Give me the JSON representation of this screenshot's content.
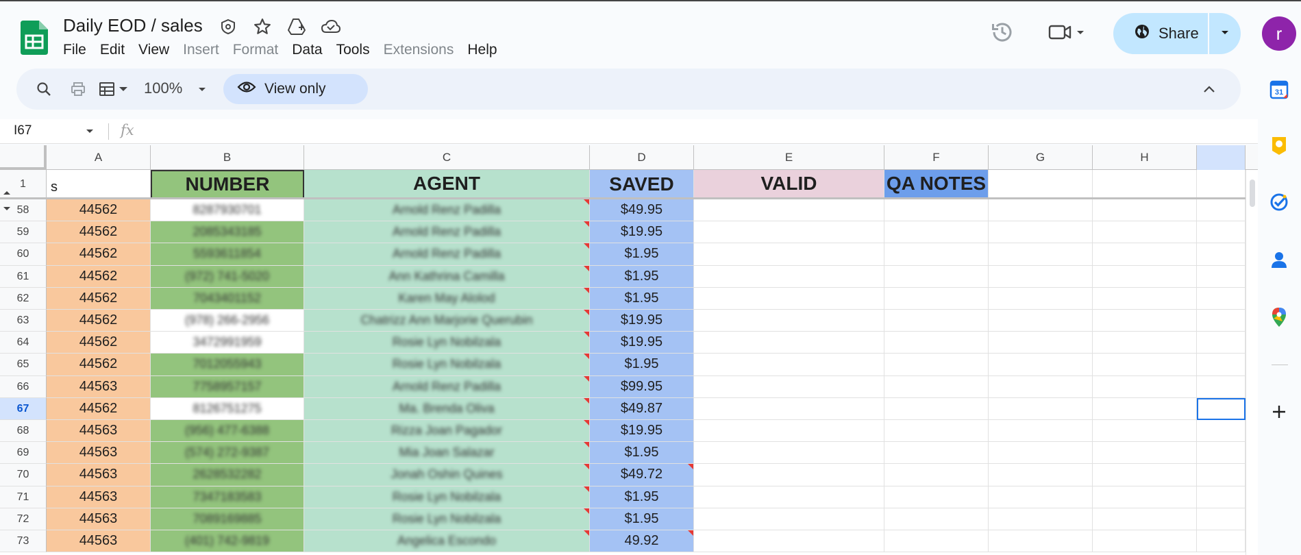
{
  "doc": {
    "title": "Daily EOD / sales"
  },
  "menu": [
    {
      "label": "File",
      "disabled": false
    },
    {
      "label": "Edit",
      "disabled": false
    },
    {
      "label": "View",
      "disabled": false
    },
    {
      "label": "Insert",
      "disabled": true
    },
    {
      "label": "Format",
      "disabled": true
    },
    {
      "label": "Data",
      "disabled": false
    },
    {
      "label": "Tools",
      "disabled": false
    },
    {
      "label": "Extensions",
      "disabled": true
    },
    {
      "label": "Help",
      "disabled": false
    }
  ],
  "header": {
    "share_label": "Share",
    "avatar_letter": "r"
  },
  "toolbar": {
    "zoom": "100%",
    "view_only_label": "View only"
  },
  "formula_bar": {
    "name_box": "I67",
    "fx_label": "fx",
    "content": ""
  },
  "colors": {
    "brand_green": "#0f9d58",
    "col_a": "#f9c89d",
    "col_b_green": "#93c47d",
    "col_c": "#b7e1cd",
    "col_d": "#a4c2f4",
    "valid_header": "#ead1dc",
    "qa_header": "#6d9eeb",
    "share_bg": "#c2e7ff"
  },
  "grid": {
    "columns": [
      "A",
      "B",
      "C",
      "D",
      "E",
      "F",
      "G",
      "H"
    ],
    "header_row": {
      "row_number": "1",
      "a": "s",
      "b": "NUMBER",
      "c": "AGENT",
      "d": "SAVED",
      "e": "VALID",
      "f": "QA NOTES"
    },
    "rows": [
      {
        "n": "58",
        "a": "44562",
        "b": "8287930701",
        "b_white": true,
        "c": "Arnold Renz Padilla",
        "d": "$49.95"
      },
      {
        "n": "59",
        "a": "44562",
        "b": "2085343185",
        "b_white": false,
        "c": "Arnold Renz Padilla",
        "d": "$19.95"
      },
      {
        "n": "60",
        "a": "44562",
        "b": "5593611854",
        "b_white": false,
        "c": "Arnold Renz Padilla",
        "d": "$1.95"
      },
      {
        "n": "61",
        "a": "44562",
        "b": "(972) 741-5020",
        "b_white": false,
        "c": "Ann Kathrina Camilla",
        "d": "$1.95"
      },
      {
        "n": "62",
        "a": "44562",
        "b": "7043401152",
        "b_white": false,
        "c": "Karen May Alolod",
        "d": "$1.95"
      },
      {
        "n": "63",
        "a": "44562",
        "b": "(978) 266-2956",
        "b_white": true,
        "c": "Chatrizz Ann Marjorie Querubin",
        "d": "$19.95"
      },
      {
        "n": "64",
        "a": "44562",
        "b": "3472991959",
        "b_white": true,
        "c": "Rosie Lyn Nobilzala",
        "d": "$19.95"
      },
      {
        "n": "65",
        "a": "44562",
        "b": "7012055943",
        "b_white": false,
        "c": "Rosie Lyn Nobilzala",
        "d": "$1.95"
      },
      {
        "n": "66",
        "a": "44563",
        "b": "7758957157",
        "b_white": false,
        "c": "Arnold Renz Padilla",
        "d": "$99.95"
      },
      {
        "n": "67",
        "a": "44562",
        "b": "8126751275",
        "b_white": true,
        "c": "Ma. Brenda Oliva",
        "d": "$49.87"
      },
      {
        "n": "68",
        "a": "44563",
        "b": "(956) 477-6388",
        "b_white": false,
        "c": "Rizza Joan Pagador",
        "d": "$19.95"
      },
      {
        "n": "69",
        "a": "44563",
        "b": "(574) 272-9387",
        "b_white": false,
        "c": "Mia Joan Salazar",
        "d": "$1.95"
      },
      {
        "n": "70",
        "a": "44563",
        "b": "2628532282",
        "b_white": false,
        "c": "Jonah Oshin Quines",
        "d": "$49.72"
      },
      {
        "n": "71",
        "a": "44563",
        "b": "7347183583",
        "b_white": false,
        "c": "Rosie Lyn Nobilzala",
        "d": "$1.95"
      },
      {
        "n": "72",
        "a": "44563",
        "b": "7089169885",
        "b_white": false,
        "c": "Rosie Lyn Nobilzala",
        "d": "$1.95"
      },
      {
        "n": "73",
        "a": "44563",
        "b": "(401) 742-9819",
        "b_white": false,
        "c": "Angelica Escondo",
        "d": "49.92"
      }
    ]
  },
  "sidebar": {
    "icons": [
      "calendar-icon",
      "keep-icon",
      "tasks-icon",
      "contacts-icon",
      "maps-icon",
      "add-icon"
    ],
    "calendar_day": "31"
  }
}
